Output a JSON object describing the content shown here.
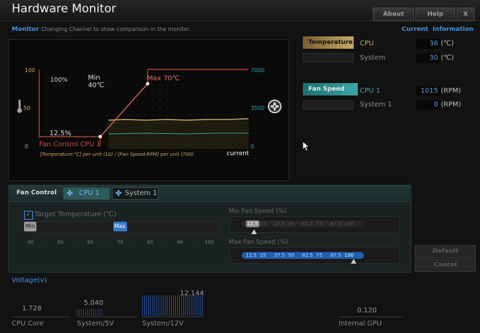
{
  "app": {
    "title": "Hardware Monitor"
  },
  "top_buttons": {
    "about": "About",
    "help": "Help",
    "close": "X"
  },
  "monitor": {
    "label": "Monitor",
    "hint": "Changing Channel to show comparison in the monitor."
  },
  "current_info": {
    "label": "Current Information",
    "temperature_tag": "Temperature",
    "fan_speed_tag": "Fan Speed",
    "temps": [
      {
        "name": "CPU",
        "value": "36",
        "unit": "(℃)"
      },
      {
        "name": "System",
        "value": "30",
        "unit": "(℃)"
      }
    ],
    "fans": [
      {
        "name": "CPU 1",
        "value": "1015",
        "unit": "(RPM)"
      },
      {
        "name": "System 1",
        "value": "0",
        "unit": "(RPM)"
      }
    ]
  },
  "chart": {
    "left_axis_top": "100",
    "left_axis_mid": "50",
    "left_axis_bottom": "0",
    "right_axis_top": "7000",
    "right_axis_mid": "3500",
    "right_axis_bottom": "0",
    "pct_top_label": "100%",
    "min_label": "Min",
    "min_value": "40℃",
    "max_label": "Max 70℃",
    "pct_bottom_label": "12.5%",
    "title": "Fan Control  CPU 1",
    "legend": "[Temperature:℃] per unit (10)  /  [Fan Speed:RPM] per unit (700)",
    "current_label": "current"
  },
  "fan_control": {
    "label": "Fan Control",
    "tabs": [
      "CPU 1",
      "System 1"
    ],
    "target_temp_label": "Target Temperature (℃)",
    "min_thumb": "Min",
    "max_thumb": "Max",
    "temp_scale": [
      "40",
      "50",
      "60",
      "70",
      "80",
      "90",
      "100"
    ],
    "min_fan_speed_label": "Min Fan Speed (%)",
    "max_fan_speed_label": "Max Fan Speed (%)",
    "fan_scale": [
      "12.5",
      "25",
      "37.5",
      "50",
      "62.5",
      "75",
      "87.5",
      "100"
    ],
    "min_fan_selected": "12.5",
    "max_fan_selected": "100",
    "min_temp_value": 40,
    "max_temp_value": 70
  },
  "actions": {
    "default": "Default",
    "cancel": "Cancel"
  },
  "voltage": {
    "label": "Voltage(v)",
    "items": [
      {
        "name": "CPU Core",
        "value": "1.728"
      },
      {
        "name": "System/5V",
        "value": "5.040"
      },
      {
        "name": "System/12V",
        "value": "12.144"
      },
      {
        "name": "Internal GPU",
        "value": "0.120"
      }
    ]
  },
  "colors": {
    "accent": "#4a90d9",
    "temperature": "#c8a868",
    "fanspeed": "#3aa8a8",
    "curve": "#d04a3a"
  }
}
